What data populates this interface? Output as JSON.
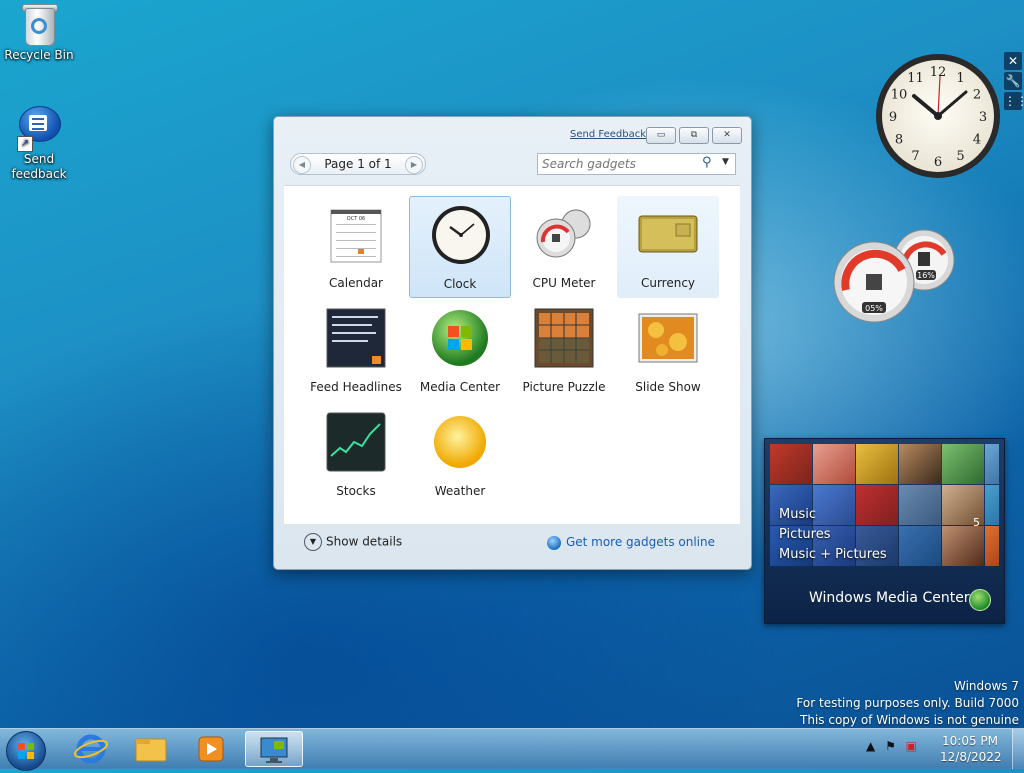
{
  "desktop": {
    "icons": [
      {
        "label": "Recycle Bin"
      },
      {
        "label": "Send feedback"
      }
    ]
  },
  "clock_gadget": {
    "numbers": [
      "12",
      "1",
      "2",
      "3",
      "4",
      "5",
      "6",
      "7",
      "8",
      "9",
      "10",
      "11"
    ]
  },
  "gadget_toolbar": {
    "close": "✕",
    "options": "🔧",
    "drag": "⋮⋮"
  },
  "cpu_gadget": {
    "cpu": "05%",
    "memory": "16%"
  },
  "media_center": {
    "menu": [
      "Music",
      "Pictures",
      "Music + Pictures"
    ],
    "brand": "Windows Media Center",
    "badge": "5"
  },
  "gallery": {
    "feedback_link": "Send Feedback",
    "page": "Page 1 of 1",
    "search_placeholder": "Search gadgets",
    "gadgets": [
      {
        "label": "Calendar"
      },
      {
        "label": "Clock"
      },
      {
        "label": "CPU Meter"
      },
      {
        "label": "Currency"
      },
      {
        "label": "Feed Headlines"
      },
      {
        "label": "Media Center"
      },
      {
        "label": "Picture Puzzle"
      },
      {
        "label": "Slide Show"
      },
      {
        "label": "Stocks"
      },
      {
        "label": "Weather"
      }
    ],
    "calendar_month": "OCT 06",
    "show_details": "Show details",
    "get_more": "Get more gadgets online"
  },
  "watermark": {
    "line1": "Windows 7",
    "line2": "For testing purposes only. Build 7000",
    "line3": "This copy of Windows is not genuine"
  },
  "taskbar": {
    "time": "10:05 PM",
    "date": "12/8/2022"
  }
}
